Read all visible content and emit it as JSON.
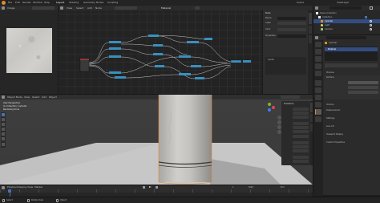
{
  "app": {
    "menus": [
      "File",
      "Edit",
      "Render",
      "Window",
      "Help"
    ],
    "workspace_tabs": [
      "Layout",
      "Shading",
      "Geometry Nodes",
      "Scripting"
    ],
    "scene_label": "Scene",
    "view_layer_label": "ViewLayer"
  },
  "image_editor": {
    "header_label": "Image",
    "image_name": "Image"
  },
  "node_editor": {
    "menus": [
      "View",
      "Select",
      "Add",
      "Node"
    ],
    "material_name": "Material",
    "npanel_title": "Node",
    "npanel_rows": [
      "Name",
      "Label",
      "Color",
      "Properties"
    ],
    "npanel_section": "Inputs"
  },
  "viewport": {
    "mode_label": "Object Mode",
    "menus": [
      "View",
      "Select",
      "Add",
      "Object"
    ],
    "overlay_line1": "User Perspective",
    "overlay_line2": "(1) Collection | Cylinder",
    "overlay_line3": "Rendering Done",
    "npanel_title": "Transform"
  },
  "outliner": {
    "items": [
      {
        "label": "Scene Collection",
        "selected": false
      },
      {
        "label": "Collection",
        "selected": false
      },
      {
        "label": "Cylinder",
        "selected": true
      },
      {
        "label": "Light",
        "selected": false
      },
      {
        "label": "Camera",
        "selected": false
      }
    ]
  },
  "properties": {
    "object_name": "Cylinder",
    "sections": [
      "Preview",
      "Surface",
      "Volume",
      "Displacement",
      "Settings",
      "Line Art",
      "Viewport Display",
      "Custom Properties"
    ],
    "material_slot": "Material"
  },
  "timeline": {
    "menus": [
      "Playback",
      "Keying",
      "View",
      "Marker"
    ],
    "current_frame": "1",
    "start_label": "Start",
    "end_label": "End"
  },
  "statusbar": {
    "left": "Select",
    "middle": "Rotate View",
    "right": "Object"
  },
  "colors": {
    "accent_orange": "#e08a2a",
    "select_blue": "#4772b3",
    "viewport_bg": "#3d3d3d",
    "floor": "#c8c8c8"
  }
}
